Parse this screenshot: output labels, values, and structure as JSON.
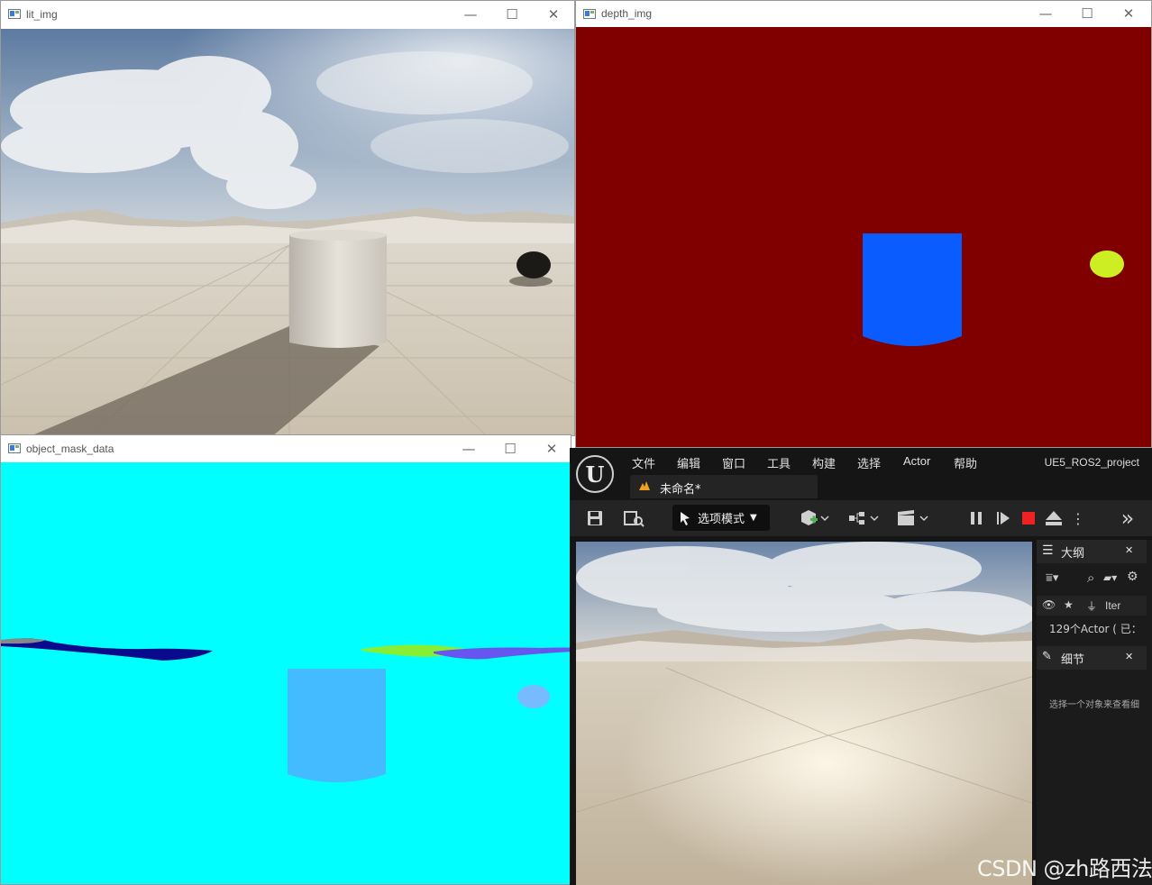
{
  "windows": {
    "lit": {
      "title": "lit_img"
    },
    "depth": {
      "title": "depth_img"
    },
    "mask": {
      "title": "object_mask_data"
    }
  },
  "window_controls": {
    "minimize": "—",
    "maximize": "☐",
    "close": "✕"
  },
  "colors": {
    "depth_background": "#800000",
    "depth_cylinder": "#0a5cff",
    "depth_sphere": "#ccee22",
    "mask_background": "#00ffff",
    "mask_cylinder": "#44bbff",
    "mask_sphere": "#77bbff",
    "ue_background": "#151515",
    "ue_panel": "#242424",
    "stop_red": "#ee2222"
  },
  "unreal_editor": {
    "menu": [
      "文件",
      "编辑",
      "窗口",
      "工具",
      "构建",
      "选择",
      "Actor",
      "帮助"
    ],
    "project_name": "UE5_ROS2_project",
    "logo_letter": "U",
    "doc_tab": "未命名*",
    "mode_button": "选项模式",
    "more_chevrons": "»",
    "outliner": {
      "title": "大纲",
      "column_label": "Iter",
      "actor_count": "129个Actor ( 已：",
      "close": "✕"
    },
    "details": {
      "title": "细节",
      "hint": "选择一个对象来查看细",
      "close": "✕"
    }
  },
  "watermark": "CSDN @zh路西法"
}
